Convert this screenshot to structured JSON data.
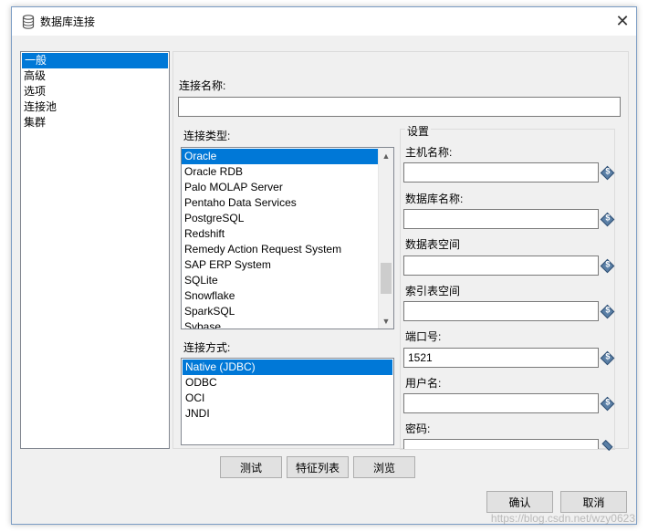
{
  "window": {
    "title": "数据库连接",
    "close_glyph": "✕"
  },
  "nav": {
    "items": [
      {
        "label": "一般",
        "selected": true
      },
      {
        "label": "高级",
        "selected": false
      },
      {
        "label": "选项",
        "selected": false
      },
      {
        "label": "连接池",
        "selected": false
      },
      {
        "label": "集群",
        "selected": false
      }
    ]
  },
  "form": {
    "connection_name_label": "连接名称:",
    "connection_name_value": "",
    "connection_type_label": "连接类型:",
    "connection_types": [
      {
        "label": "Oracle",
        "selected": true
      },
      {
        "label": "Oracle RDB",
        "selected": false
      },
      {
        "label": "Palo MOLAP Server",
        "selected": false
      },
      {
        "label": "Pentaho Data Services",
        "selected": false
      },
      {
        "label": "PostgreSQL",
        "selected": false
      },
      {
        "label": "Redshift",
        "selected": false
      },
      {
        "label": "Remedy Action Request System",
        "selected": false
      },
      {
        "label": "SAP ERP System",
        "selected": false
      },
      {
        "label": "SQLite",
        "selected": false
      },
      {
        "label": "Snowflake",
        "selected": false
      },
      {
        "label": "SparkSQL",
        "selected": false
      },
      {
        "label": "Sybase",
        "selected": false
      }
    ],
    "access_method_label": "连接方式:",
    "access_methods": [
      {
        "label": "Native (JDBC)",
        "selected": true
      },
      {
        "label": "ODBC",
        "selected": false
      },
      {
        "label": "OCI",
        "selected": false
      },
      {
        "label": "JNDI",
        "selected": false
      }
    ],
    "settings": {
      "title": "设置",
      "host_label": "主机名称:",
      "host_value": "",
      "database_label": "数据库名称:",
      "database_value": "",
      "tablespace_label": "数据表空间",
      "tablespace_value": "",
      "index_tablespace_label": "索引表空间",
      "index_tablespace_value": "",
      "port_label": "端口号:",
      "port_value": "1521",
      "user_label": "用户名:",
      "user_value": "",
      "password_label": "密码:",
      "password_value": ""
    }
  },
  "buttons": {
    "test": "测试",
    "feature_list": "特征列表",
    "explore": "浏览",
    "ok": "确认",
    "cancel": "取消"
  },
  "watermark": "https://blog.csdn.net/wzy0623",
  "colors": {
    "selection": "#0078d7",
    "window_bg": "#f0f0f0"
  }
}
